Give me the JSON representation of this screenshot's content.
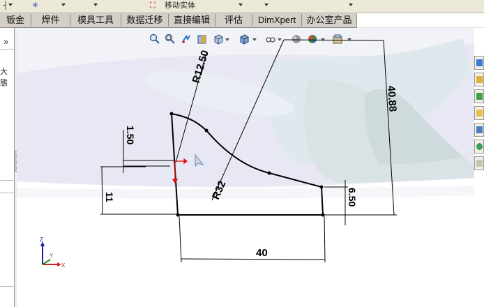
{
  "toolbar": {
    "move_body_label": "移动实体"
  },
  "tabs": [
    {
      "label": "钣金"
    },
    {
      "label": "焊件"
    },
    {
      "label": "模具工具"
    },
    {
      "label": "数据迁移"
    },
    {
      "label": "直接编辑"
    },
    {
      "label": "评估"
    },
    {
      "label": "DimXpert"
    },
    {
      "label": "办公室产品"
    }
  ],
  "left_panel": {
    "collapse_glyph": "»",
    "partial_label": "大態"
  },
  "sketch": {
    "dimensions": {
      "radius_arc": "R12.50",
      "radius_curve": "R32",
      "height_total": "40.88",
      "offset_small": "1.50",
      "height_left": "11",
      "height_right": "6.50",
      "width_bottom": "40"
    }
  },
  "icons": {
    "view_toolbar": [
      "zoom-to-fit-icon",
      "zoom-to-area-icon",
      "previous-view-icon",
      "section-view-icon",
      "view-orientation-icon",
      "display-style-icon",
      "hide-show-items-icon",
      "edit-appearance-icon",
      "apply-scene-icon",
      "view-settings-icon"
    ],
    "right_taskpane": [
      "solidworks-resources-icon",
      "design-library-icon",
      "file-explorer-icon",
      "folder-icon",
      "view-palette-icon",
      "appearances-icon",
      "custom-properties-icon"
    ]
  },
  "colors": {
    "sketch_line": "#000000",
    "origin_red": "#e01010",
    "axis_blue": "#1a1aa8",
    "tab_bar": "#d4d0c8"
  }
}
